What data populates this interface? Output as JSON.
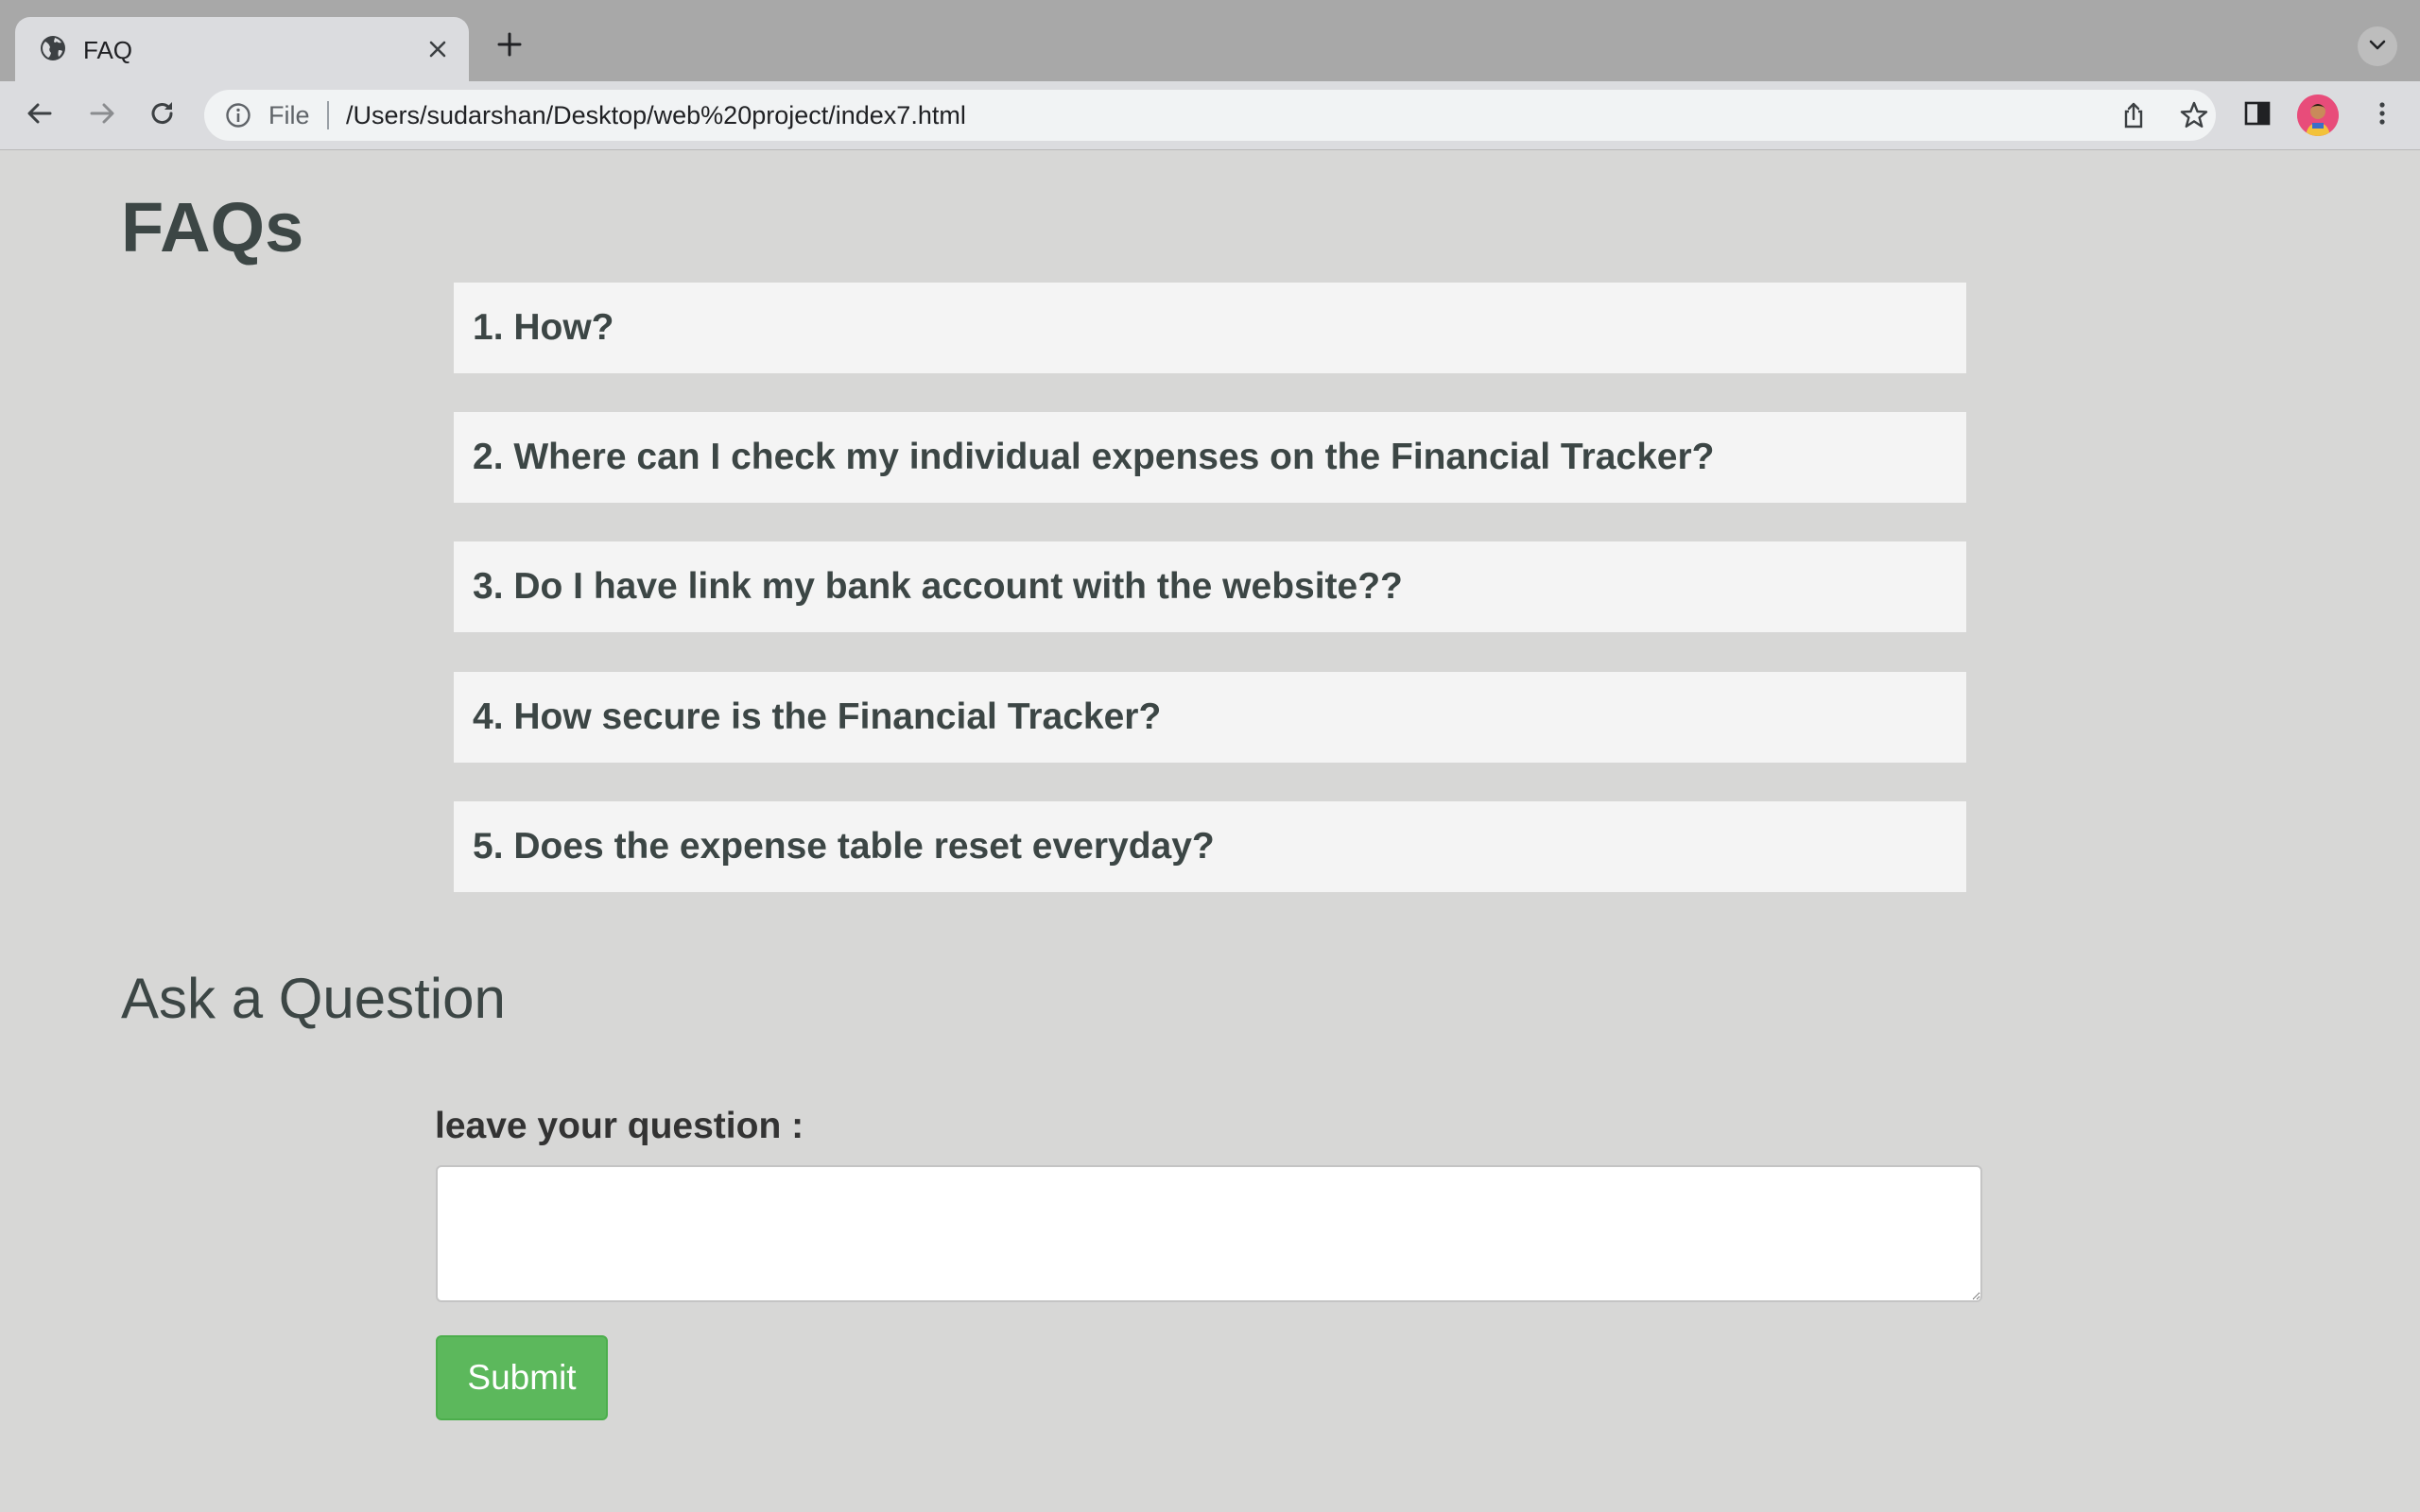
{
  "browser": {
    "tab_title": "FAQ",
    "scheme_label": "File",
    "url": "/Users/sudarshan/Desktop/web%20project/index7.html",
    "icons": [
      "globe-icon",
      "close-icon",
      "plus-icon",
      "chevron-down-icon",
      "back-arrow-icon",
      "forward-arrow-icon",
      "reload-icon",
      "info-icon",
      "share-icon",
      "star-icon",
      "side-panel-icon",
      "avatar",
      "kebab-menu-icon"
    ]
  },
  "page": {
    "title": "FAQs",
    "faqs": [
      "1. How?",
      "2. Where can I check my individual expenses on the Financial Tracker?",
      "3. Do I have link my bank account with the website??",
      "4. How secure is the Financial Tracker?",
      "5. Does the expense table reset everyday?"
    ],
    "ask": {
      "title": "Ask a Question",
      "label": "leave your question :",
      "textarea_value": "",
      "submit_label": "Submit"
    }
  },
  "colors": {
    "page_background": "#d7d7d6",
    "faq_background": "#f4f4f4",
    "heading_text": "#3c4645",
    "submit_button": "#5cb85c"
  }
}
